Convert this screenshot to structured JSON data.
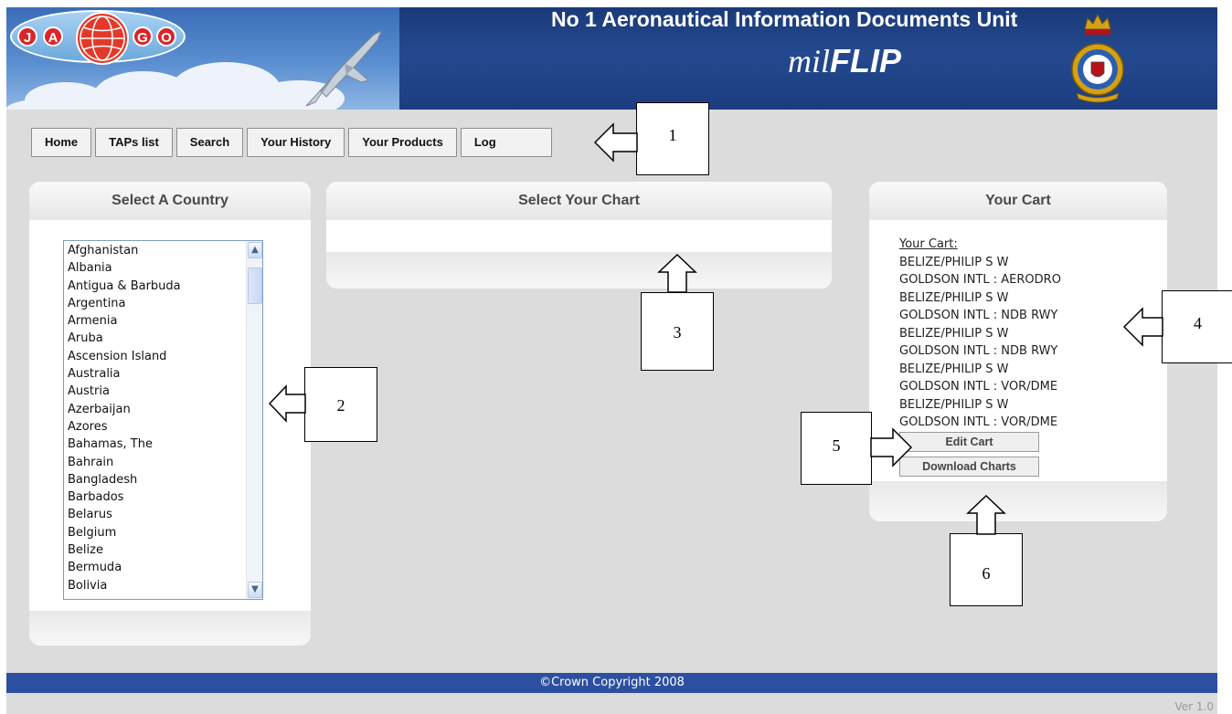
{
  "header": {
    "title": "No 1 Aeronautical Information Documents Unit",
    "brand_prefix": "mil",
    "brand_main": "FLIP",
    "logo_letters": [
      "J",
      "A",
      "G",
      "O"
    ]
  },
  "nav": {
    "items": [
      {
        "label": "Home"
      },
      {
        "label": "TAPs list"
      },
      {
        "label": "Search"
      },
      {
        "label": "Your History"
      },
      {
        "label": "Your Products"
      },
      {
        "label": "Log"
      }
    ]
  },
  "country_panel": {
    "title": "Select A Country",
    "options": [
      "Afghanistan",
      "Albania",
      "Antigua & Barbuda",
      "Argentina",
      "Armenia",
      "Aruba",
      "Ascension Island",
      "Australia",
      "Austria",
      "Azerbaijan",
      "Azores",
      "Bahamas, The",
      "Bahrain",
      "Bangladesh",
      "Barbados",
      "Belarus",
      "Belgium",
      "Belize",
      "Bermuda",
      "Bolivia"
    ]
  },
  "chart_panel": {
    "title": "Select Your Chart"
  },
  "cart_panel": {
    "title": "Your Cart",
    "heading": "Your Cart:",
    "lines": [
      "BELIZE/PHILIP S W",
      "GOLDSON INTL : AERODRO",
      "BELIZE/PHILIP S W",
      "GOLDSON INTL : NDB RWY",
      "BELIZE/PHILIP S W",
      "GOLDSON INTL : NDB RWY",
      "BELIZE/PHILIP S W",
      "GOLDSON INTL : VOR/DME",
      "BELIZE/PHILIP S W",
      "GOLDSON INTL : VOR/DME"
    ],
    "edit_label": "Edit Cart",
    "download_label": "Download Charts"
  },
  "footer": {
    "copyright": "©Crown Copyright 2008",
    "version": "Ver 1.0"
  },
  "callouts": {
    "c1": "1",
    "c2": "2",
    "c3": "3",
    "c4": "4",
    "c5": "5",
    "c6": "6"
  },
  "colors": {
    "banner_blue": "#1c3d80",
    "footer_blue": "#2c4fa0",
    "page_gray": "#dcdcdc"
  }
}
